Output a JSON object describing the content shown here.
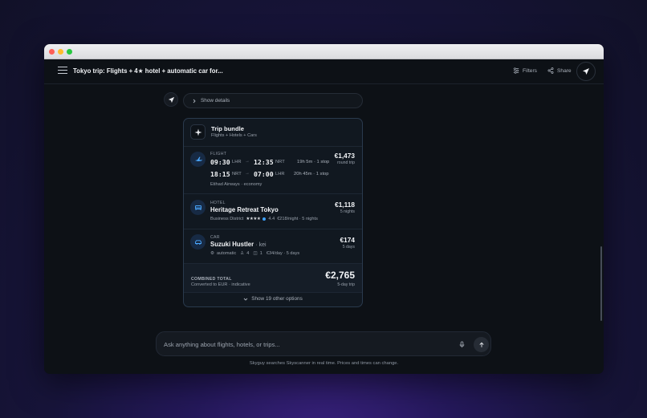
{
  "header": {
    "title": "Tokyo trip: Flights + 4★ hotel + automatic car for...",
    "filters_label": "Filters",
    "share_label": "Share"
  },
  "details": {
    "label": "Show details"
  },
  "bundle": {
    "title": "Trip bundle",
    "subtitle": "Flights + Hotels + Cars",
    "flight": {
      "label": "FLIGHT",
      "legs": [
        {
          "depart": "09:30",
          "from": "LHR",
          "arrive": "12:35",
          "to": "NRT",
          "duration": "19h 5m · 1 stop"
        },
        {
          "depart": "18:15",
          "from": "NRT",
          "arrive": "07:00",
          "to": "LHR",
          "duration": "20h 45m · 1 stop"
        }
      ],
      "airline": "Etihad Airways · economy",
      "price": "€1,473",
      "price_note": "round trip"
    },
    "hotel": {
      "label": "HOTEL",
      "name": "Heritage Retreat Tokyo",
      "district": "Business District",
      "stars": "★★★★",
      "rating": "4.4",
      "nightly": "€218/night · 5 nights",
      "price": "€1,118",
      "price_note": "5 nights"
    },
    "car": {
      "label": "CAR",
      "name": "Suzuki Hustler",
      "class": "· kei",
      "transmission": "automatic",
      "seats": "4",
      "bags": "1",
      "rate": "€34/day · 5 days",
      "price": "€174",
      "price_note": "5 days"
    },
    "total": {
      "label": "COMBINED TOTAL",
      "note": "Converted to EUR · indicative",
      "price": "€2,765",
      "price_note": "5-day trip"
    },
    "more_label": "Show 19 other options"
  },
  "composer": {
    "placeholder": "Ask anything about flights, hotels, or trips..."
  },
  "footnote": "Skyguy searches Skyscanner in real time. Prices and times can change.",
  "colors": {
    "accent": "#3ea2ff",
    "background": "#0d1116",
    "card_border": "#2a3a4d"
  }
}
